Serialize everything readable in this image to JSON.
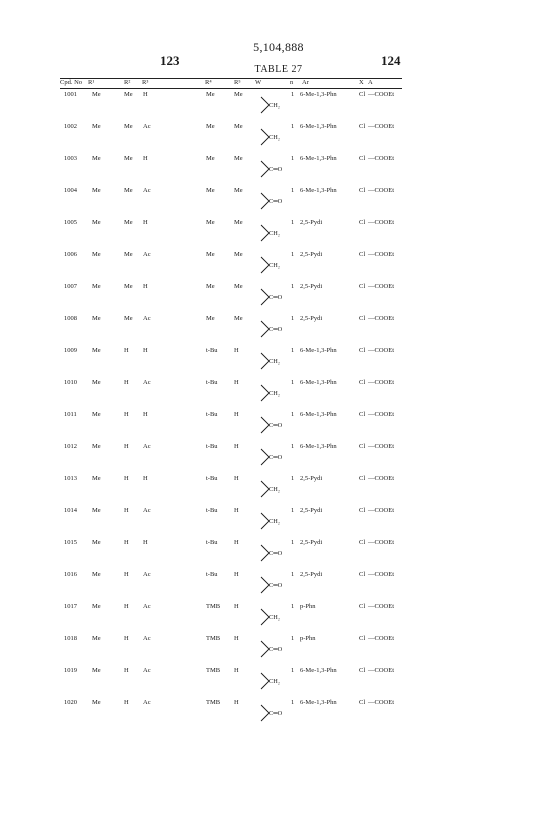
{
  "patent_number": "5,104,888",
  "page_left": "123",
  "page_right": "124",
  "table_title": "TABLE 27",
  "columns": [
    "Cpd. No",
    "R¹",
    "R²",
    "R³",
    "R⁴",
    "R⁵",
    "W",
    "n",
    "Ar",
    "X",
    "A"
  ],
  "rows": [
    {
      "cpd": "1001",
      "r1": "Me",
      "r2": "Me",
      "r3": "H",
      "r4": "Me",
      "r5": "Me",
      "w": "CH₂",
      "n": "1",
      "ar": "6-Me-1,3-Phn",
      "x": "Cl",
      "a": "—COOEt"
    },
    {
      "cpd": "1002",
      "r1": "Me",
      "r2": "Me",
      "r3": "Ac",
      "r4": "Me",
      "r5": "Me",
      "w": "CH₂",
      "n": "1",
      "ar": "6-Me-1,3-Phn",
      "x": "Cl",
      "a": "—COOEt"
    },
    {
      "cpd": "1003",
      "r1": "Me",
      "r2": "Me",
      "r3": "H",
      "r4": "Me",
      "r5": "Me",
      "w": "C═O",
      "n": "1",
      "ar": "6-Me-1,3-Phn",
      "x": "Cl",
      "a": "—COOEt"
    },
    {
      "cpd": "1004",
      "r1": "Me",
      "r2": "Me",
      "r3": "Ac",
      "r4": "Me",
      "r5": "Me",
      "w": "C═O",
      "n": "1",
      "ar": "6-Me-1,3-Phn",
      "x": "Cl",
      "a": "—COOEt"
    },
    {
      "cpd": "1005",
      "r1": "Me",
      "r2": "Me",
      "r3": "H",
      "r4": "Me",
      "r5": "Me",
      "w": "CH₂",
      "n": "1",
      "ar": "2,5-Pydi",
      "x": "Cl",
      "a": "—COOEt"
    },
    {
      "cpd": "1006",
      "r1": "Me",
      "r2": "Me",
      "r3": "Ac",
      "r4": "Me",
      "r5": "Me",
      "w": "CH₂",
      "n": "1",
      "ar": "2,5-Pydi",
      "x": "Cl",
      "a": "—COOEt"
    },
    {
      "cpd": "1007",
      "r1": "Me",
      "r2": "Me",
      "r3": "H",
      "r4": "Me",
      "r5": "Me",
      "w": "C═O",
      "n": "1",
      "ar": "2,5-Pydi",
      "x": "Cl",
      "a": "—COOEt"
    },
    {
      "cpd": "1008",
      "r1": "Me",
      "r2": "Me",
      "r3": "Ac",
      "r4": "Me",
      "r5": "Me",
      "w": "C═O",
      "n": "1",
      "ar": "2,5-Pydi",
      "x": "Cl",
      "a": "—COOEt"
    },
    {
      "cpd": "1009",
      "r1": "Me",
      "r2": "H",
      "r3": "H",
      "r4": "t-Bu",
      "r5": "H",
      "w": "CH₂",
      "n": "1",
      "ar": "6-Me-1,3-Phn",
      "x": "Cl",
      "a": "—COOEt"
    },
    {
      "cpd": "1010",
      "r1": "Me",
      "r2": "H",
      "r3": "Ac",
      "r4": "t-Bu",
      "r5": "H",
      "w": "CH₂",
      "n": "1",
      "ar": "6-Me-1,3-Phn",
      "x": "Cl",
      "a": "—COOEt"
    },
    {
      "cpd": "1011",
      "r1": "Me",
      "r2": "H",
      "r3": "H",
      "r4": "t-Bu",
      "r5": "H",
      "w": "C═O",
      "n": "1",
      "ar": "6-Me-1,3-Phn",
      "x": "Cl",
      "a": "—COOEt"
    },
    {
      "cpd": "1012",
      "r1": "Me",
      "r2": "H",
      "r3": "Ac",
      "r4": "t-Bu",
      "r5": "H",
      "w": "C═O",
      "n": "1",
      "ar": "6-Me-1,3-Phn",
      "x": "Cl",
      "a": "—COOEt"
    },
    {
      "cpd": "1013",
      "r1": "Me",
      "r2": "H",
      "r3": "H",
      "r4": "t-Bu",
      "r5": "H",
      "w": "CH₂",
      "n": "1",
      "ar": "2,5-Pydi",
      "x": "Cl",
      "a": "—COOEt"
    },
    {
      "cpd": "1014",
      "r1": "Me",
      "r2": "H",
      "r3": "Ac",
      "r4": "t-Bu",
      "r5": "H",
      "w": "CH₂",
      "n": "1",
      "ar": "2,5-Pydi",
      "x": "Cl",
      "a": "—COOEt"
    },
    {
      "cpd": "1015",
      "r1": "Me",
      "r2": "H",
      "r3": "H",
      "r4": "t-Bu",
      "r5": "H",
      "w": "C═O",
      "n": "1",
      "ar": "2,5-Pydi",
      "x": "Cl",
      "a": "—COOEt"
    },
    {
      "cpd": "1016",
      "r1": "Me",
      "r2": "H",
      "r3": "Ac",
      "r4": "t-Bu",
      "r5": "H",
      "w": "C═O",
      "n": "1",
      "ar": "2,5-Pydi",
      "x": "Cl",
      "a": "—COOEt"
    },
    {
      "cpd": "1017",
      "r1": "Me",
      "r2": "H",
      "r3": "Ac",
      "r4": "TMB",
      "r5": "H",
      "w": "CH₂",
      "n": "1",
      "ar": "p-Phn",
      "x": "Cl",
      "a": "—COOEt"
    },
    {
      "cpd": "1018",
      "r1": "Me",
      "r2": "H",
      "r3": "Ac",
      "r4": "TMB",
      "r5": "H",
      "w": "C═O",
      "n": "1",
      "ar": "p-Phn",
      "x": "Cl",
      "a": "—COOEt"
    },
    {
      "cpd": "1019",
      "r1": "Me",
      "r2": "H",
      "r3": "Ac",
      "r4": "TMB",
      "r5": "H",
      "w": "CH₂",
      "n": "1",
      "ar": "6-Me-1,3-Phn",
      "x": "Cl",
      "a": "—COOEt"
    },
    {
      "cpd": "1020",
      "r1": "Me",
      "r2": "H",
      "r3": "Ac",
      "r4": "TMB",
      "r5": "H",
      "w": "C═O",
      "n": "1",
      "ar": "6-Me-1,3-Phn",
      "x": "Cl",
      "a": "—COOEt"
    }
  ]
}
